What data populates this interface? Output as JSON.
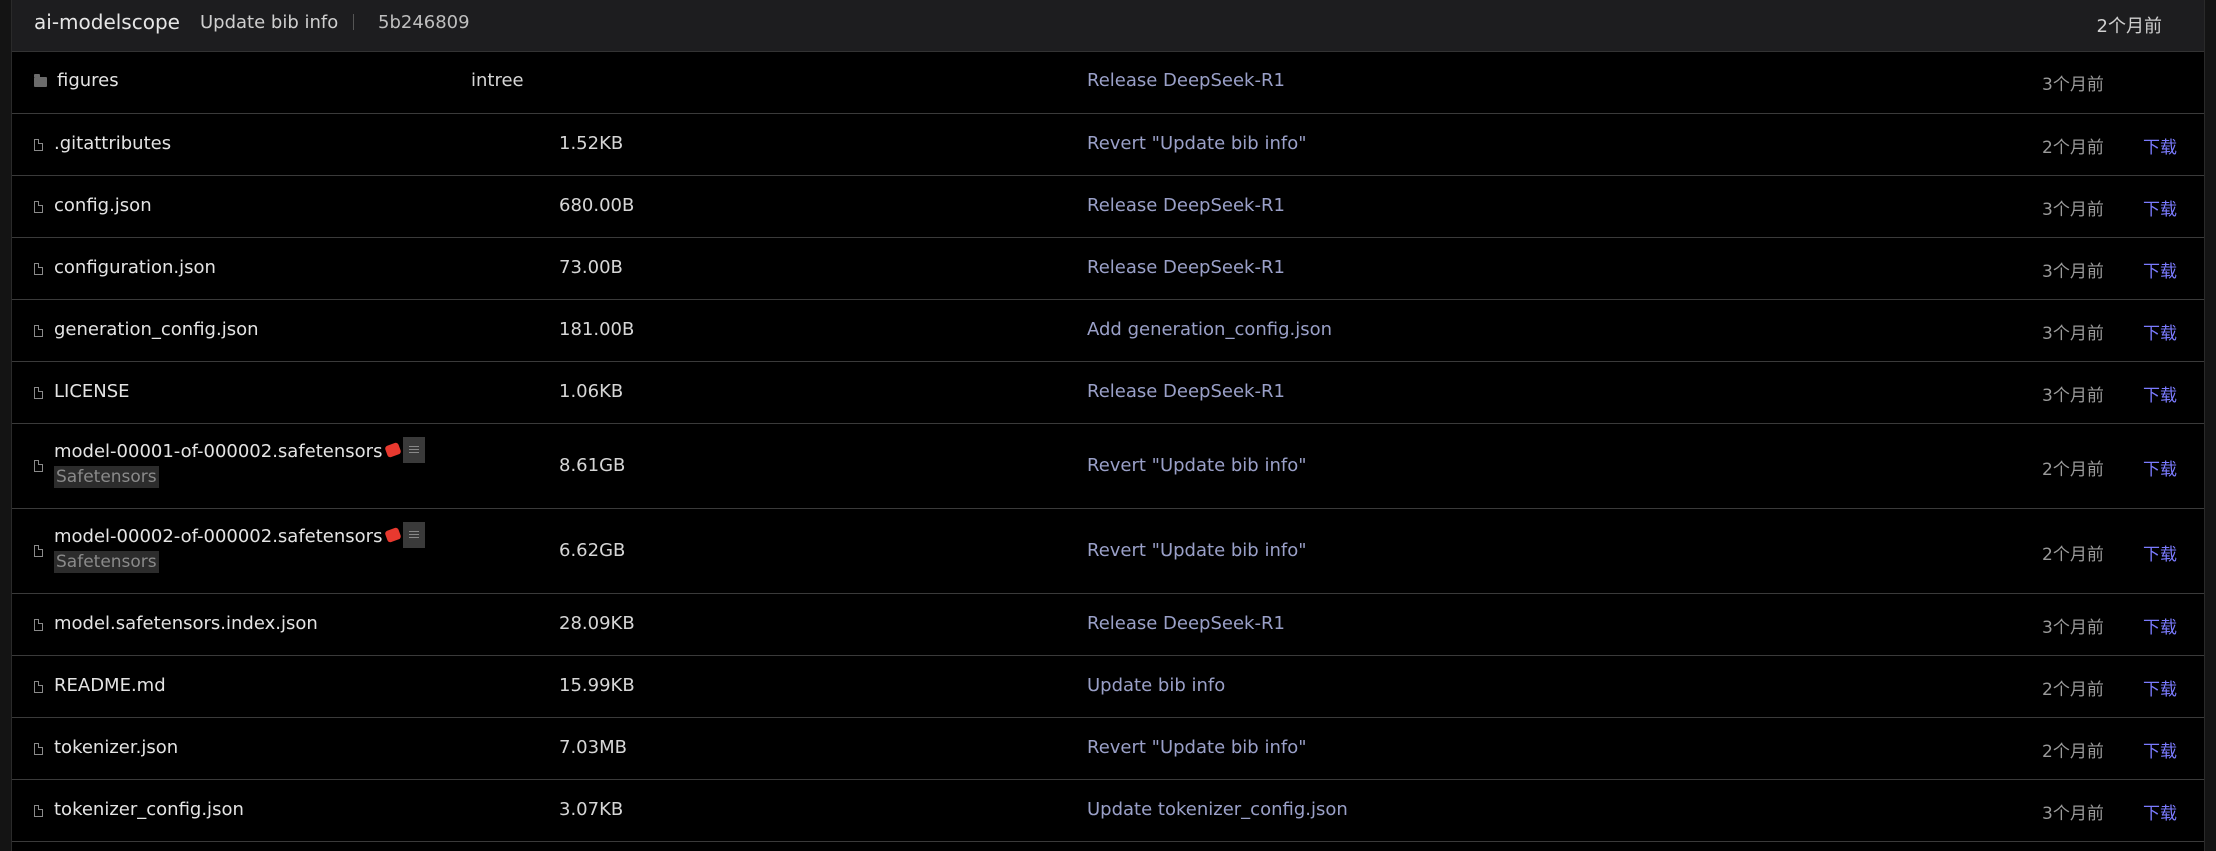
{
  "header": {
    "author": "ai-modelscope",
    "commit_message": "Update bib info",
    "commit_hash": "5b246809",
    "time": "2个月前"
  },
  "files": [
    {
      "type": "folder",
      "name": "figures",
      "size": "",
      "intree": "intree",
      "message": "Release DeepSeek-R1",
      "date": "3个月前",
      "download": ""
    },
    {
      "type": "file",
      "name": ".gitattributes",
      "size": "1.52KB",
      "message": "Revert \"Update bib info\"",
      "date": "2个月前",
      "download": "下载"
    },
    {
      "type": "file",
      "name": "config.json",
      "size": "680.00B",
      "message": "Release DeepSeek-R1",
      "date": "3个月前",
      "download": "下载"
    },
    {
      "type": "file",
      "name": "configuration.json",
      "size": "73.00B",
      "message": "Release DeepSeek-R1",
      "date": "3个月前",
      "download": "下载"
    },
    {
      "type": "file",
      "name": "generation_config.json",
      "size": "181.00B",
      "message": "Add generation_config.json",
      "date": "3个月前",
      "download": "下载"
    },
    {
      "type": "file",
      "name": "LICENSE",
      "size": "1.06KB",
      "message": "Release DeepSeek-R1",
      "date": "3个月前",
      "download": "下载"
    },
    {
      "type": "file",
      "name": "model-00001-of-000002.safetensors",
      "size": "8.61GB",
      "message": "Revert \"Update bib info\"",
      "date": "2个月前",
      "download": "下载",
      "tag": "Safetensors"
    },
    {
      "type": "file",
      "name": "model-00002-of-000002.safetensors",
      "size": "6.62GB",
      "message": "Revert \"Update bib info\"",
      "date": "2个月前",
      "download": "下载",
      "tag": "Safetensors"
    },
    {
      "type": "file",
      "name": "model.safetensors.index.json",
      "size": "28.09KB",
      "message": "Release DeepSeek-R1",
      "date": "3个月前",
      "download": "下载"
    },
    {
      "type": "file",
      "name": "README.md",
      "size": "15.99KB",
      "message": "Update bib info",
      "date": "2个月前",
      "download": "下载"
    },
    {
      "type": "file",
      "name": "tokenizer.json",
      "size": "7.03MB",
      "message": "Revert \"Update bib info\"",
      "date": "2个月前",
      "download": "下载"
    },
    {
      "type": "file",
      "name": "tokenizer_config.json",
      "size": "3.07KB",
      "message": "Update tokenizer_config.json",
      "date": "3个月前",
      "download": "下载"
    }
  ]
}
